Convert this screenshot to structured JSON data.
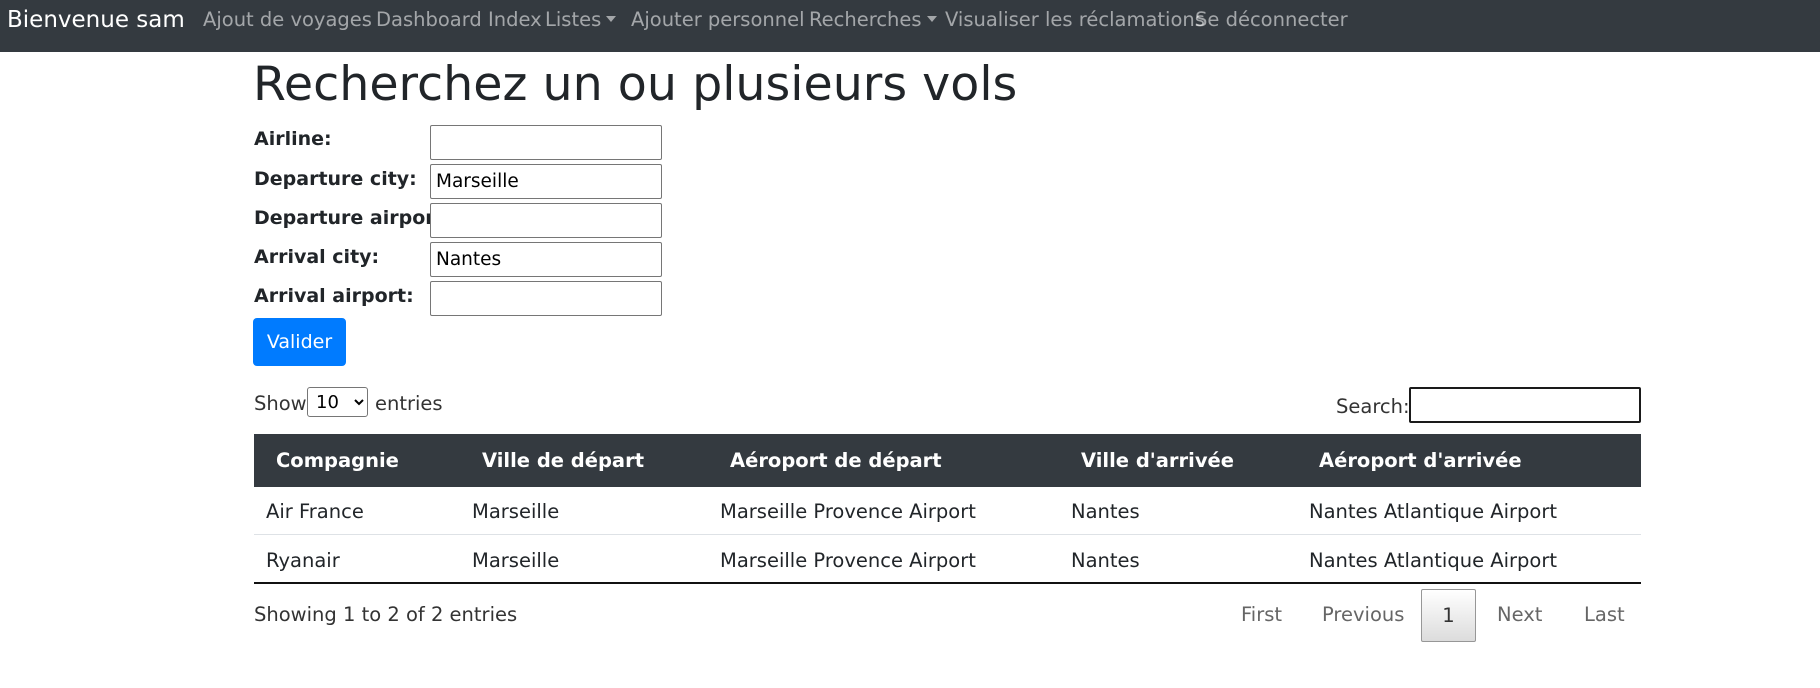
{
  "navbar": {
    "brand": "Bienvenue sam",
    "items": [
      {
        "label": "Ajout de voyages"
      },
      {
        "label": "Dashboard Index"
      },
      {
        "label": "Listes"
      },
      {
        "label": "Ajouter personnel"
      },
      {
        "label": "Recherches"
      },
      {
        "label": "Visualiser les réclamations"
      },
      {
        "label": "Se déconnecter"
      }
    ]
  },
  "page": {
    "title": "Recherchez un ou plusieurs vols"
  },
  "form": {
    "fields": [
      {
        "label": "Airline:",
        "value": ""
      },
      {
        "label": "Departure city:",
        "value": "Marseille"
      },
      {
        "label": "Departure airport:",
        "value": ""
      },
      {
        "label": "Arrival city:",
        "value": "Nantes"
      },
      {
        "label": "Arrival airport:",
        "value": ""
      }
    ],
    "submit_label": "Valider"
  },
  "datatable": {
    "show_label": "Show",
    "page_length": "10",
    "entries_label": "entries",
    "search_label": "Search:",
    "search_value": "",
    "columns": [
      "Compagnie",
      "Ville de départ",
      "Aéroport de départ",
      "Ville d'arrivée",
      "Aéroport d'arrivée"
    ],
    "rows": [
      [
        "Air France",
        "Marseille",
        "Marseille Provence Airport",
        "Nantes",
        "Nantes Atlantique Airport"
      ],
      [
        "Ryanair",
        "Marseille",
        "Marseille Provence Airport",
        "Nantes",
        "Nantes Atlantique Airport"
      ]
    ],
    "info": "Showing 1 to 2 of 2 entries",
    "pagination": {
      "first": "First",
      "previous": "Previous",
      "current": "1",
      "next": "Next",
      "last": "Last"
    }
  },
  "colors": {
    "navbar_bg": "#343a40",
    "primary": "#007bff",
    "table_header_bg": "#343a40"
  },
  "icons": {
    "dropdown": "chevron-down-icon"
  }
}
